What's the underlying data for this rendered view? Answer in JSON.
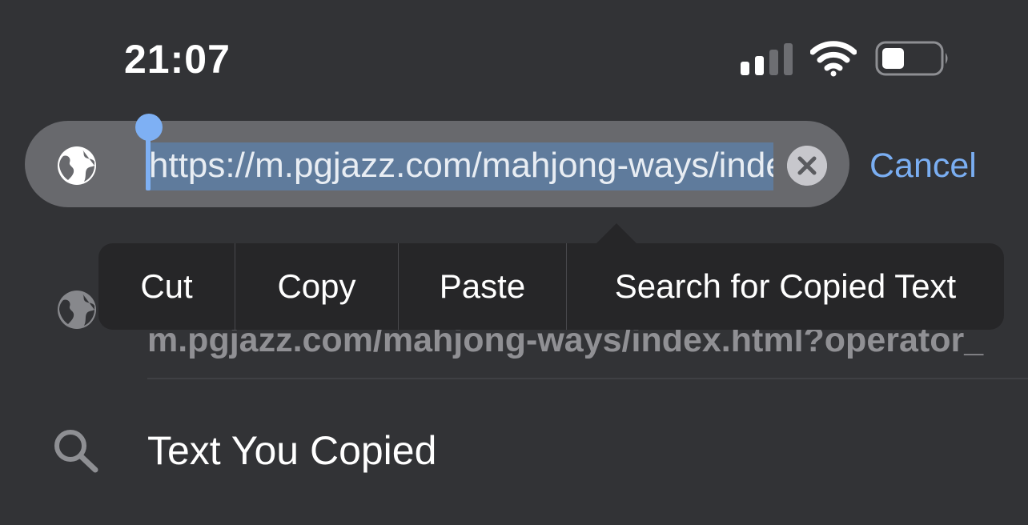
{
  "status_bar": {
    "time": "21:07"
  },
  "address_bar": {
    "url": "https://m.pgjazz.com/mahjong-ways/index.html?operator_",
    "cancel_label": "Cancel"
  },
  "edit_menu": {
    "items": [
      {
        "label": "Cut"
      },
      {
        "label": "Copy"
      },
      {
        "label": "Paste"
      },
      {
        "label": "Search for Copied Text"
      }
    ]
  },
  "suggestions": {
    "url_suggestion": "m.pgjazz.com/mahjong-ways/index.html?operator_",
    "copied_text_label": "Text You Copied"
  },
  "colors": {
    "background": "#323336",
    "accent": "#7aaef2",
    "selection": "#5f7b9c",
    "menu_background": "#262628"
  },
  "icons": [
    "cellular-signal-icon",
    "wifi-icon",
    "battery-icon",
    "globe-icon",
    "clear-icon",
    "search-icon"
  ]
}
